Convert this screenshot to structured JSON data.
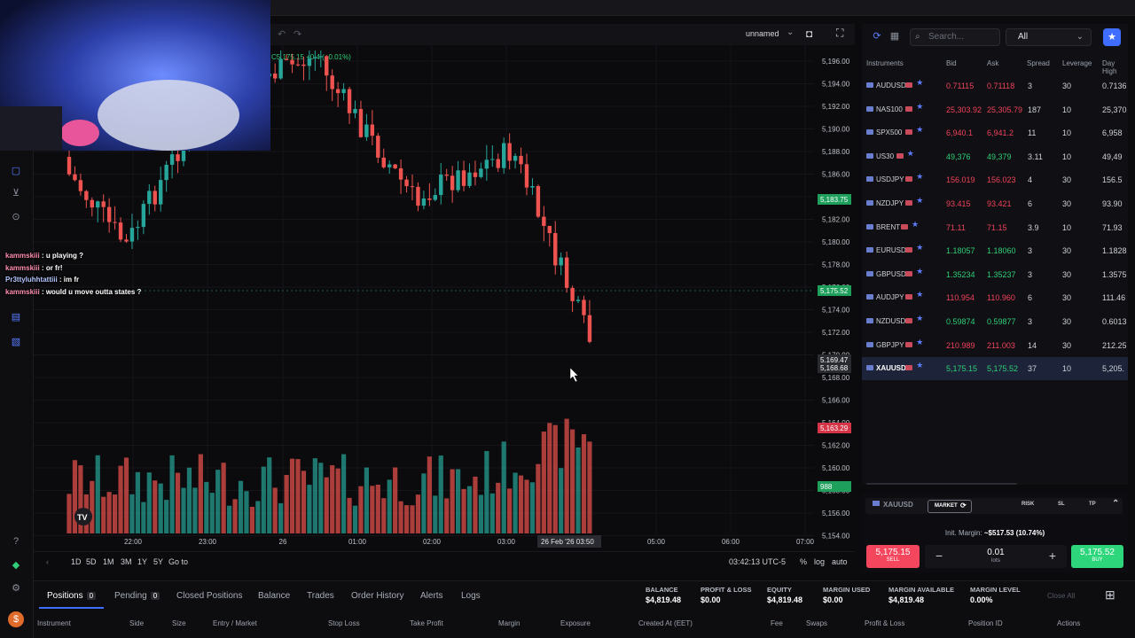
{
  "chart": {
    "layout_name": "unnamed",
    "ohlc_label": "C5,175.15 +0.4 (+0.01%)",
    "price_ticks": [
      "5,196.00",
      "5,194.00",
      "5,192.00",
      "5,190.00",
      "5,188.00",
      "5,186.00",
      "5,184.00",
      "5,182.00",
      "5,180.00",
      "5,178.00",
      "5,176.00",
      "5,174.00",
      "5,172.00",
      "5,170.00",
      "5,168.00",
      "5,166.00",
      "5,164.00",
      "5,162.00",
      "5,160.00",
      "5,158.00",
      "5,156.00",
      "5,154.00"
    ],
    "price_tags": {
      "green1": "5,183.75",
      "green2": "5,175.52",
      "grey1": "5,169.47",
      "grey2": "5,168.68",
      "red": "5,163.29",
      "volume": "988"
    },
    "time_ticks": [
      "22:00",
      "23:00",
      "26",
      "01:00",
      "02:00",
      "03:00",
      "05:00",
      "06:00",
      "07:00"
    ],
    "crosshair_date": "26 Feb '26",
    "crosshair_time": "03:50",
    "timeframes": [
      "1D",
      "5D",
      "1M",
      "3M",
      "1Y",
      "5Y",
      "Go to"
    ],
    "clock": "03:42:13 UTC-5",
    "scale_options": [
      "%",
      "log",
      "auto"
    ]
  },
  "chat": [
    {
      "user": "kammskiii",
      "msg": "u playing ?"
    },
    {
      "user": "kammskiii",
      "msg": "or fr!"
    },
    {
      "user": "Pr3ttyluhhtattiii",
      "msg": "im fr"
    },
    {
      "user": "kammskiii",
      "msg": "would u move outta states ?"
    }
  ],
  "watchlist": {
    "search_placeholder": "Search...",
    "filter": "All",
    "columns": [
      "Instruments",
      "Bid",
      "Ask",
      "Spread",
      "Leverage",
      "Day High"
    ],
    "rows": [
      {
        "symbol": "AUDUSD",
        "bid": "0.71115",
        "ask": "0.71118",
        "spread": "3",
        "leverage": "30",
        "day_high": "0.7136",
        "color": "red"
      },
      {
        "symbol": "NAS100",
        "bid": "25,303.92",
        "ask": "25,305.79",
        "spread": "187",
        "leverage": "10",
        "day_high": "25,370",
        "color": "red"
      },
      {
        "symbol": "SPX500",
        "bid": "6,940.1",
        "ask": "6,941.2",
        "spread": "11",
        "leverage": "10",
        "day_high": "6,958",
        "color": "red"
      },
      {
        "symbol": "US30",
        "bid": "49,376",
        "ask": "49,379",
        "spread": "3.11",
        "leverage": "10",
        "day_high": "49,49",
        "color": "green"
      },
      {
        "symbol": "USDJPY",
        "bid": "156.019",
        "ask": "156.023",
        "spread": "4",
        "leverage": "30",
        "day_high": "156.5",
        "color": "red"
      },
      {
        "symbol": "NZDJPY",
        "bid": "93.415",
        "ask": "93.421",
        "spread": "6",
        "leverage": "30",
        "day_high": "93.90",
        "color": "red"
      },
      {
        "symbol": "BRENT",
        "bid": "71.11",
        "ask": "71.15",
        "spread": "3.9",
        "leverage": "10",
        "day_high": "71.93",
        "color": "red"
      },
      {
        "symbol": "EURUSD",
        "bid": "1.18057",
        "ask": "1.18060",
        "spread": "3",
        "leverage": "30",
        "day_high": "1.1828",
        "color": "green"
      },
      {
        "symbol": "GBPUSD",
        "bid": "1.35234",
        "ask": "1.35237",
        "spread": "3",
        "leverage": "30",
        "day_high": "1.3575",
        "color": "green"
      },
      {
        "symbol": "AUDJPY",
        "bid": "110.954",
        "ask": "110.960",
        "spread": "6",
        "leverage": "30",
        "day_high": "111.46",
        "color": "red"
      },
      {
        "symbol": "NZDUSD",
        "bid": "0.59874",
        "ask": "0.59877",
        "spread": "3",
        "leverage": "30",
        "day_high": "0.6013",
        "color": "green"
      },
      {
        "symbol": "GBPJPY",
        "bid": "210.989",
        "ask": "211.003",
        "spread": "14",
        "leverage": "30",
        "day_high": "212.25",
        "color": "red"
      },
      {
        "symbol": "XAUUSD",
        "bid": "5,175.15",
        "ask": "5,175.52",
        "spread": "37",
        "leverage": "10",
        "day_high": "5,205.",
        "color": "green",
        "selected": true
      }
    ]
  },
  "order": {
    "symbol": "XAUUSD",
    "tabs": {
      "market": "MARKET",
      "risk": "RISK",
      "sl": "SL",
      "tp": "TP"
    },
    "margin_label": "Init. Margin:",
    "margin_value": "~$517.53 (10.74%)",
    "sell_price": "5,175.15",
    "sell_label": "SELL",
    "lots_value": "0.01",
    "lots_label": "lots",
    "buy_price": "5,175.52",
    "buy_label": "BUY"
  },
  "bottom": {
    "tabs": [
      "Positions",
      "Pending",
      "Closed Positions",
      "Balance",
      "Trades",
      "Order History",
      "Alerts",
      "Logs"
    ],
    "positions_count": "0",
    "pending_count": "0",
    "stats": [
      {
        "label": "BALANCE",
        "value": "$4,819.48"
      },
      {
        "label": "PROFIT & LOSS",
        "value": "$0.00"
      },
      {
        "label": "EQUITY",
        "value": "$4,819.48"
      },
      {
        "label": "MARGIN USED",
        "value": "$0.00"
      },
      {
        "label": "MARGIN AVAILABLE",
        "value": "$4,819.48"
      },
      {
        "label": "MARGIN LEVEL",
        "value": "0.00%"
      }
    ],
    "close_all": "Close All",
    "columns": [
      "Instrument",
      "Side",
      "Size",
      "Entry / Market",
      "Stop Loss",
      "Take Profit",
      "Margin",
      "Exposure",
      "Created At (EET)",
      "Fee",
      "Swaps",
      "Profit & Loss",
      "Position ID",
      "Actions"
    ]
  },
  "colors": {
    "bull": "#26a69a",
    "bear": "#ef5350",
    "accent": "#3f6dff",
    "sell": "#f4475e",
    "buy": "#2ed67b"
  }
}
